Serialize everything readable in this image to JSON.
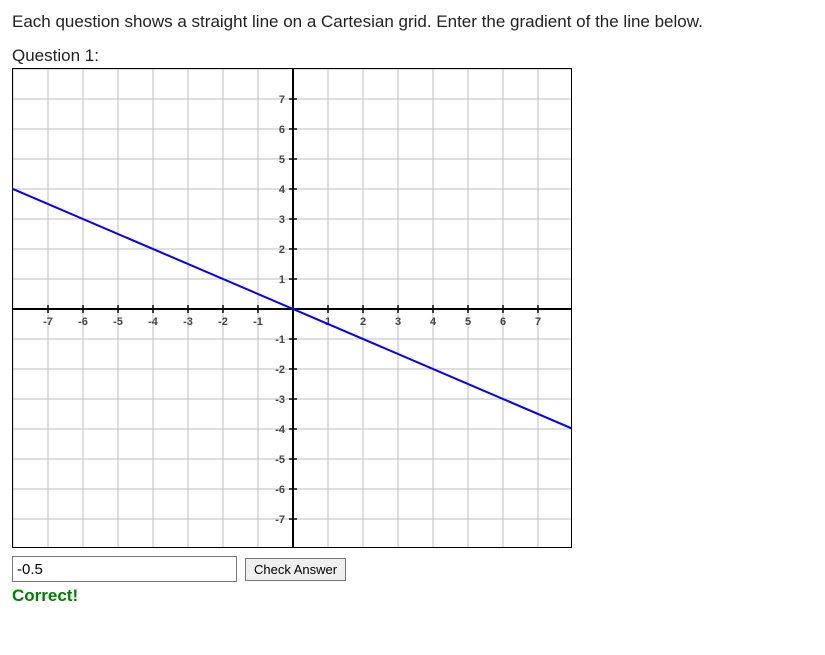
{
  "intro_text": "Each question shows a straight line on a Cartesian grid. Enter the gradient of the line below.",
  "question_label": "Question 1:",
  "answer_value": "-0.5",
  "check_button_label": "Check Answer",
  "feedback_text": "Correct!",
  "chart_data": {
    "type": "line",
    "title": "",
    "xlabel": "",
    "ylabel": "",
    "xlim": [
      -8,
      8
    ],
    "ylim": [
      -8,
      8
    ],
    "x_ticks": [
      -7,
      -6,
      -5,
      -4,
      -3,
      -2,
      -1,
      1,
      2,
      3,
      4,
      5,
      6,
      7
    ],
    "y_ticks": [
      -7,
      -6,
      -5,
      -4,
      -3,
      -2,
      -1,
      1,
      2,
      3,
      4,
      5,
      6,
      7
    ],
    "grid": true,
    "line": {
      "slope": -0.5,
      "intercept": 0,
      "points": [
        {
          "x": -8,
          "y": 4
        },
        {
          "x": 8,
          "y": -4
        }
      ],
      "color": "#0000ff"
    }
  }
}
